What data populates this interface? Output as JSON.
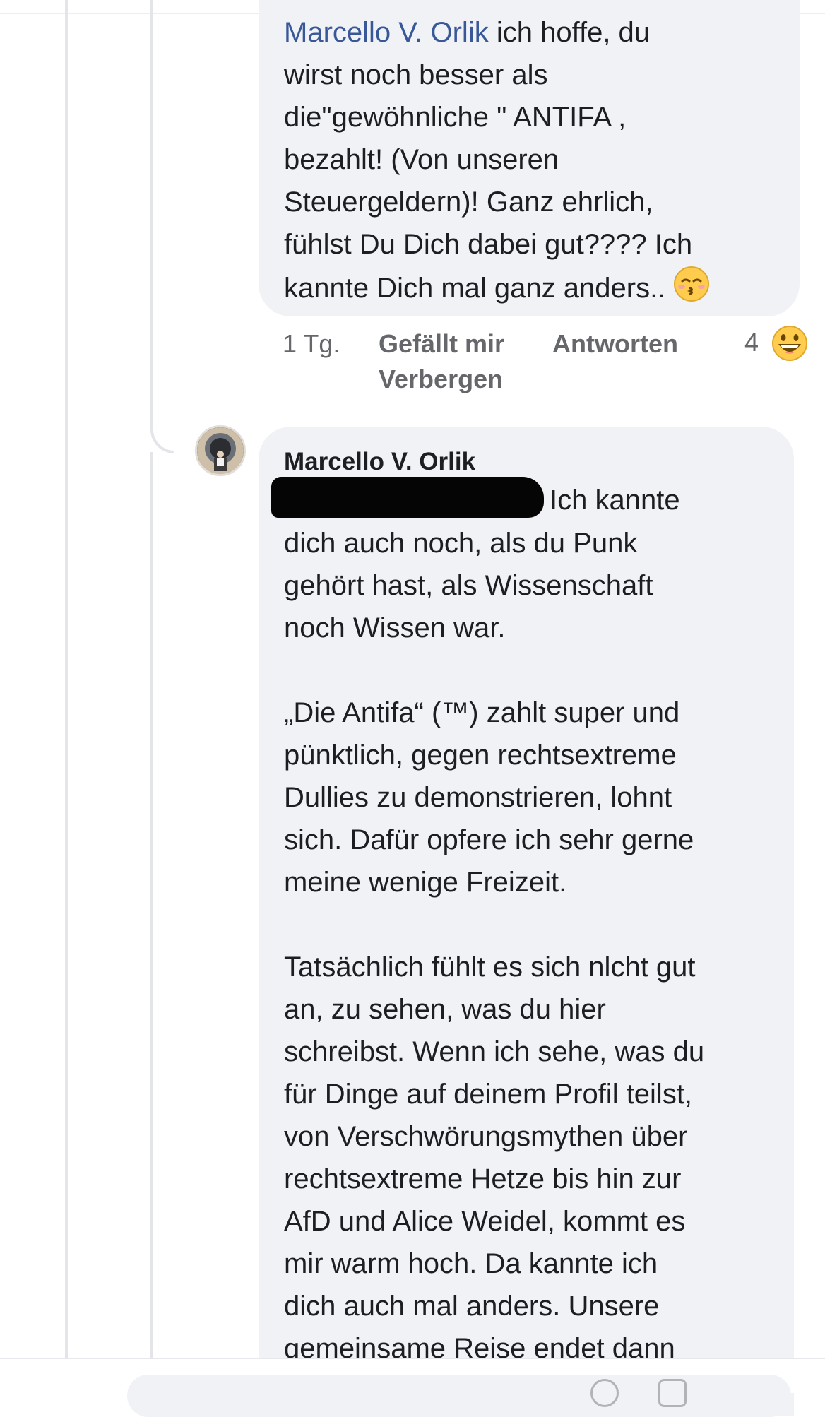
{
  "comment1": {
    "mention": "Marcello V. Orlik",
    "text": " ich hoffe, du\nwirst noch besser als\ndie\"gewöhnliche \" ANTIFA ,\nbezahlt! (Von unseren\nSteuergeldern)!  Ganz ehrlich,\nfühlst Du Dich dabei gut???? Ich\nkannte Dich mal ganz anders.. ",
    "emoji": "kissing-face-with-closed-eyes",
    "time": "1 Tg.",
    "like_label": "Gefällt mir",
    "reply_label": "Antworten",
    "hide_label": "Verbergen",
    "reaction_count": "4",
    "reaction_emoji": "grinning-face"
  },
  "comment2": {
    "author": "Marcello V. Orlik",
    "text_first_line": "Ich kannte",
    "text": "dich auch noch, als du Punk\ngehört hast, als Wissenschaft\nnoch Wissen war.\n\n„Die Antifa“ (™) zahlt super und\npünktlich, gegen rechtsextreme\nDullies zu demonstrieren, lohnt\nsich. Dafür opfere ich sehr gerne\nmeine wenige Freizeit.\n\nTatsächlich fühlt es sich nlcht gut\nan, zu sehen, was du hier\nschreibst. Wenn ich sehe, was du\nfür Dinge auf deinem Profil teilst,\nvon Verschwörungsmythen über\nrechtsextreme Hetze bis hin zur\nAfD und Alice Weidel, kommt es\nmir warm hoch. Da kannte ich\ndich auch mal anders. Unsere\ngemeinsame Reise endet dann"
  },
  "colors": {
    "bubble": "#f0f2f5",
    "mention": "#385898",
    "meta": "#65676b",
    "thread_line": "#e3e5e8"
  }
}
